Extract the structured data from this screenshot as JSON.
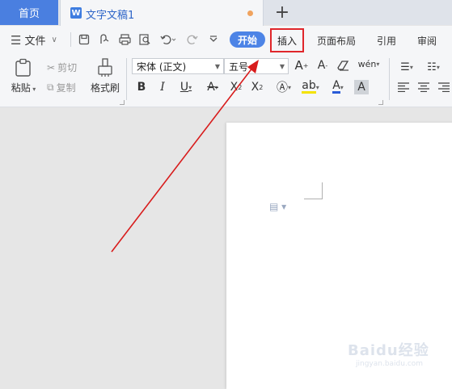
{
  "tabs": {
    "home_label": "首页",
    "doc_title": "文字文稿1",
    "doc_logo": "W",
    "new_tab_symbol": "+"
  },
  "menu": {
    "file_label": "文件"
  },
  "ribbon_tabs": {
    "start": "开始",
    "insert": "插入",
    "layout": "页面布局",
    "reference": "引用",
    "review": "审阅"
  },
  "clipboard": {
    "paste": "粘贴",
    "cut": "剪切",
    "copy": "复制",
    "format_painter": "格式刷"
  },
  "font": {
    "name": "宋体 (正文)",
    "size": "五号"
  },
  "icons": [
    "menu-icon",
    "save-icon",
    "export-icon",
    "print-icon",
    "print-preview-icon",
    "undo-icon",
    "redo-icon",
    "more-icon",
    "paste-icon",
    "scissors-icon",
    "copy-icon",
    "brush-icon",
    "bold-icon",
    "italic-icon",
    "underline-icon",
    "strikethrough-icon",
    "superscript-icon",
    "subscript-icon",
    "grow-font-icon",
    "shrink-font-icon",
    "clear-format-icon",
    "phonetic-icon",
    "text-effect-icon",
    "highlight-icon",
    "font-color-icon",
    "char-shading-icon",
    "bullet-list-icon",
    "numbered-list-icon",
    "align-left-icon",
    "align-center-icon",
    "align-right-icon",
    "paragraph-mark-icon"
  ],
  "colors": {
    "accent": "#4d84e6",
    "highlight_box": "#e0262b",
    "arrow": "#d81c1c",
    "unsaved_dot": "#f0a35e"
  },
  "watermark": {
    "text": "Baidu经验",
    "sub": "jingyan.baidu.com"
  }
}
